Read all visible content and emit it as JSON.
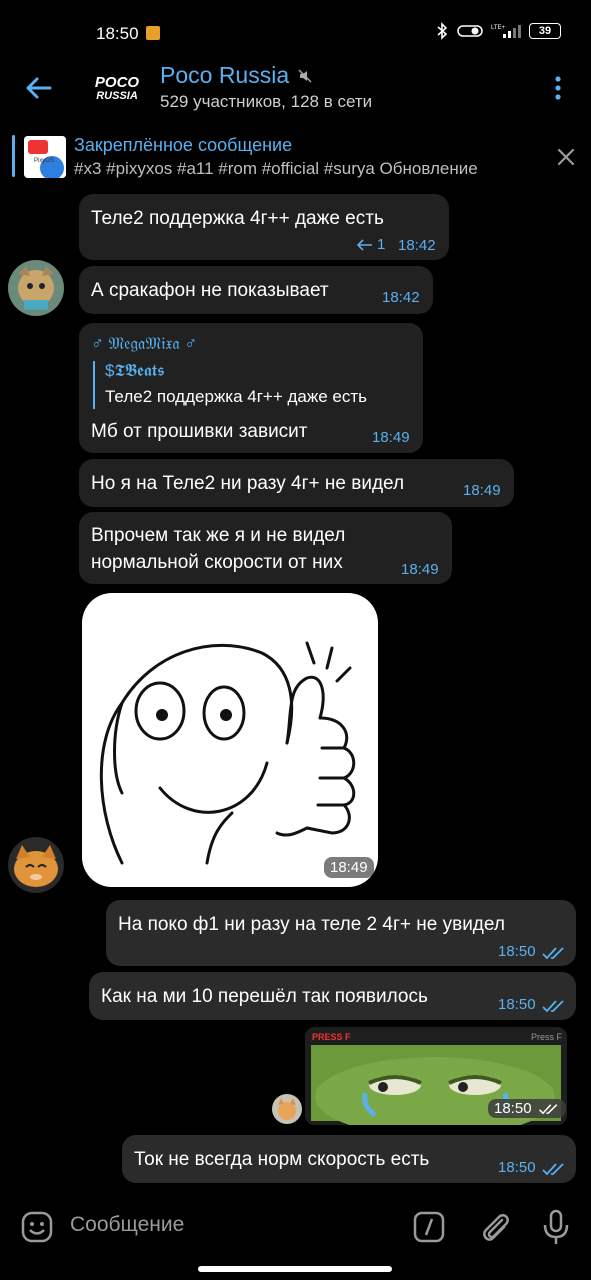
{
  "status_bar": {
    "time": "18:50",
    "battery": "39"
  },
  "header": {
    "logo_line1": "POCO",
    "logo_line2": "RUSSIA",
    "title": "Poco Russia",
    "subtitle": "529 участников, 128 в сети"
  },
  "pinned": {
    "title": "Закреплённое сообщение",
    "text": "#x3 #pixyxos #a11 #rom #official #surya Обновление"
  },
  "messages": [
    {
      "text": "Теле2 поддержка 4г++ даже есть",
      "replies": "1",
      "time": "18:42"
    },
    {
      "text": "А сракафон не показывает",
      "time": "18:42"
    },
    {
      "sender": "♂ 𝔐𝔢𝔤𝔞𝔐𝔦𝔵𝔞 ♂",
      "reply_name": "$𝕿𝕭𝖊𝖆𝖙𝖘",
      "reply_text": "Теле2 поддержка 4г++ даже есть",
      "text": "Мб от прошивки зависит",
      "time": "18:49"
    },
    {
      "text": "Но я на Теле2 ни разу 4г+ не видел",
      "time": "18:49"
    },
    {
      "text_line1": "Впрочем так же я и не видел",
      "text_line2": "нормальной скорости от них",
      "time": "18:49"
    },
    {
      "sticker": "meme-thumbs-up",
      "time": "18:49"
    },
    {
      "text": "На поко ф1 ни разу на теле 2 4г+ не увидел",
      "time": "18:50"
    },
    {
      "text": "Как на ми 10 перешёл так появилось",
      "time": "18:50"
    },
    {
      "gif_label_left": "PRESS F",
      "gif_label_right": "Press F",
      "time": "18:50"
    },
    {
      "text": "Ток не всегда норм скорость есть",
      "time": "18:50"
    }
  ],
  "input": {
    "placeholder": "Сообщение"
  }
}
